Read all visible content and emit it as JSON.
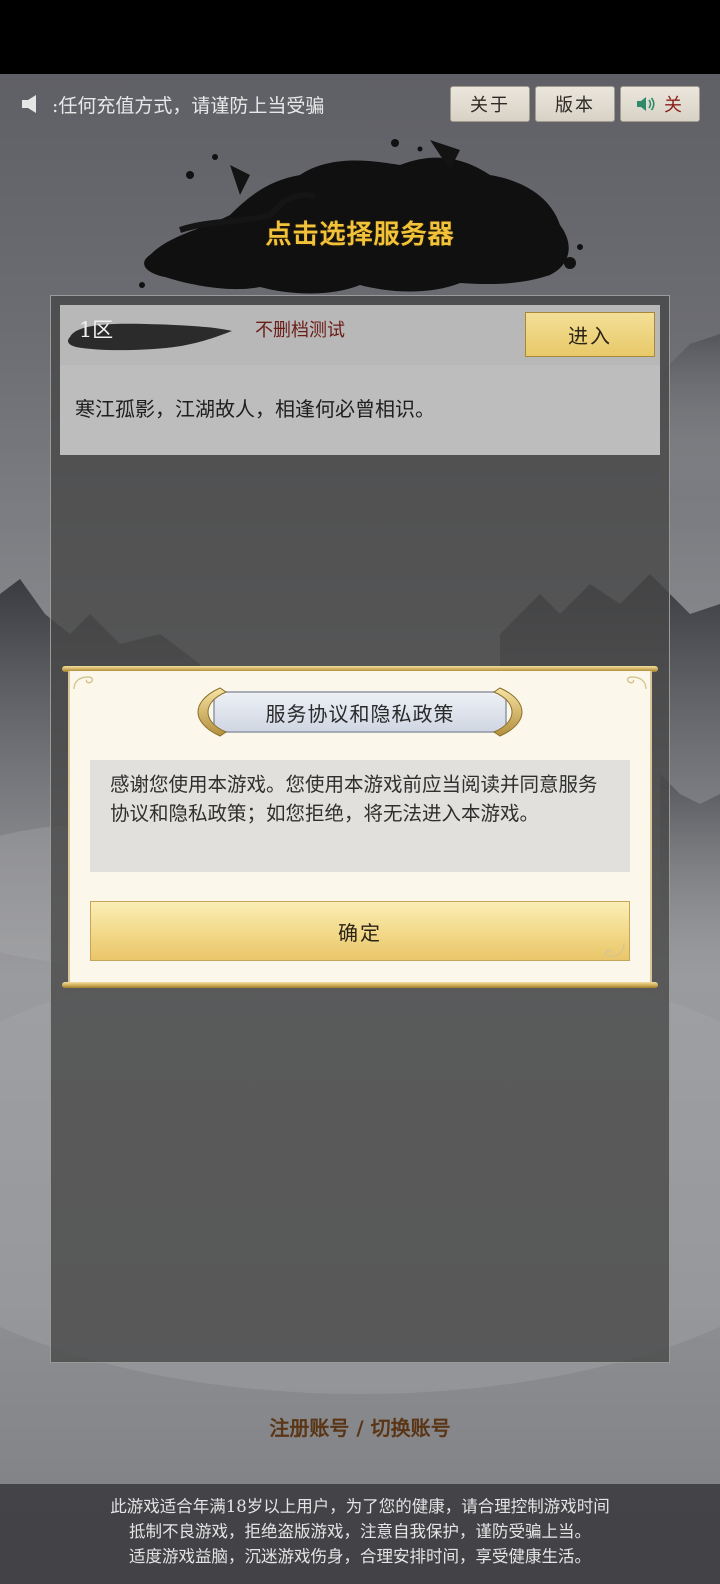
{
  "top_bar": {
    "notice": ":任何充值方式，请谨防上当受骗",
    "about_label": "关于",
    "version_label": "版本",
    "sound_label": "关"
  },
  "title": "点击选择服务器",
  "server": {
    "zone": "1区",
    "tag": "不删档测试",
    "enter_label": "进入",
    "description": "寒江孤影，江湖故人，相逢何必曾相识。"
  },
  "dialog": {
    "title": "服务协议和隐私政策",
    "message": "感谢您使用本游戏。您使用本游戏前应当阅读并同意服务协议和隐私政策；如您拒绝，将无法进入本游戏。",
    "confirm_label": "确定"
  },
  "account": {
    "register_label": "注册账号",
    "separator": " / ",
    "switch_label": "切换账号"
  },
  "footer": {
    "line1": "此游戏适合年满18岁以上用户，为了您的健康，请合理控制游戏时间",
    "line2": "抵制不良游戏，拒绝盗版游戏，注意自我保护，谨防受骗上当。",
    "line3": "适度游戏益脑，沉迷游戏伤身，合理安排时间，享受健康生活。"
  },
  "colors": {
    "title_gold": "#f2c23a",
    "sound_red": "#8a1f1a",
    "account_brown": "#5a3616",
    "button_gold": "#e8c969"
  }
}
